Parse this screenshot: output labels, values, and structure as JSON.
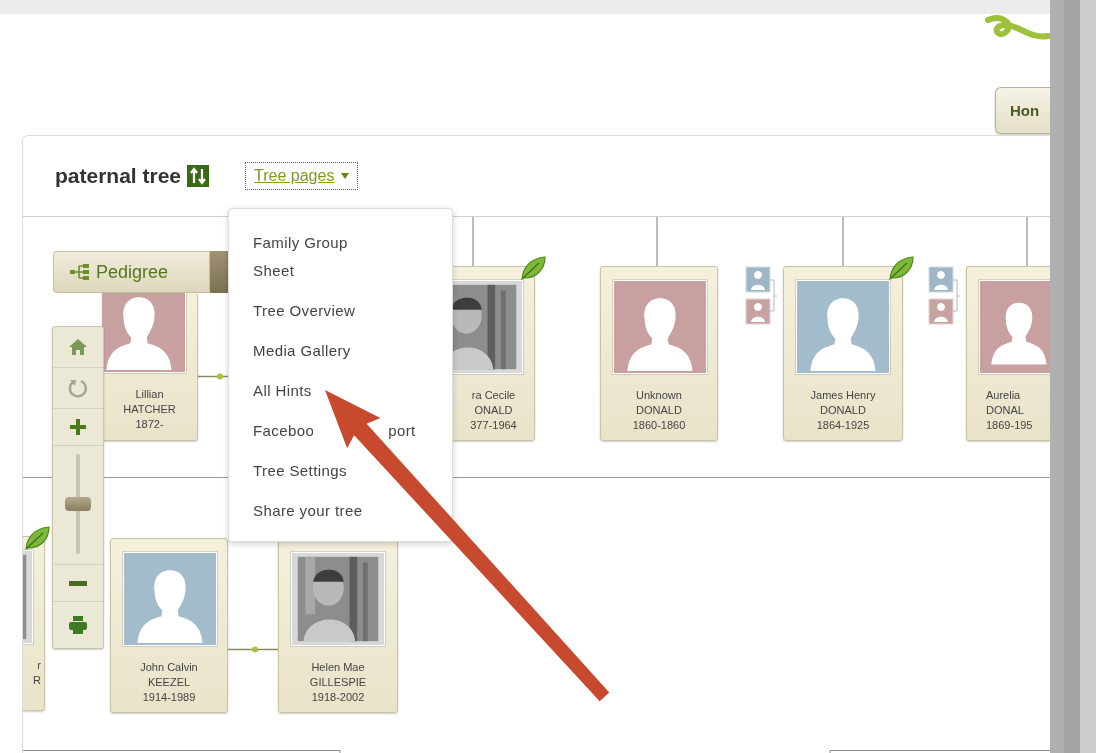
{
  "header": {
    "home_button": "Hon"
  },
  "tree": {
    "title": "paternal tree",
    "pages_menu": {
      "label": "Tree pages",
      "expanded": true,
      "items": [
        {
          "label": "Family Group Sheet"
        },
        {
          "label": "Tree Overview"
        },
        {
          "label": "Media Gallery"
        },
        {
          "label": "All Hints"
        },
        {
          "label": "Faceboo",
          "label_after": "port"
        },
        {
          "label": "Tree Settings"
        },
        {
          "label": "Share your tree"
        }
      ]
    }
  },
  "view_button": {
    "label": "Pedigree"
  },
  "zoom": {
    "level": 0.5
  },
  "people": [
    {
      "given": "Lillian",
      "surname": "HATCHER",
      "years": "1872-",
      "kind": "female",
      "hint": false,
      "parents": false
    },
    {
      "given": "ra Cecile",
      "surname": "ONALD",
      "years": "377-1964",
      "hint": true,
      "parents": false
    },
    {
      "given": "Unknown",
      "surname": "DONALD",
      "years": "1860-1860",
      "kind": "female",
      "hint": false,
      "parents": false
    },
    {
      "given": "James Henry",
      "surname": "DONALD",
      "years": "1864-1925",
      "kind": "male",
      "hint": true,
      "parents": true
    },
    {
      "given": "Aurelia",
      "surname": "DONAL",
      "years": "1869-195",
      "kind": "female",
      "hint": false,
      "parents": true
    },
    {
      "given": "r",
      "surname": "R",
      "hint": true,
      "parents": false
    },
    {
      "given": "John Calvin",
      "surname": "KEEZEL",
      "years": "1914-1989",
      "kind": "male",
      "hint": false,
      "parents": false
    },
    {
      "given": "Helen Mae",
      "surname": "GILLESPIE",
      "years": "1918-2002",
      "hint": false,
      "parents": false
    }
  ]
}
